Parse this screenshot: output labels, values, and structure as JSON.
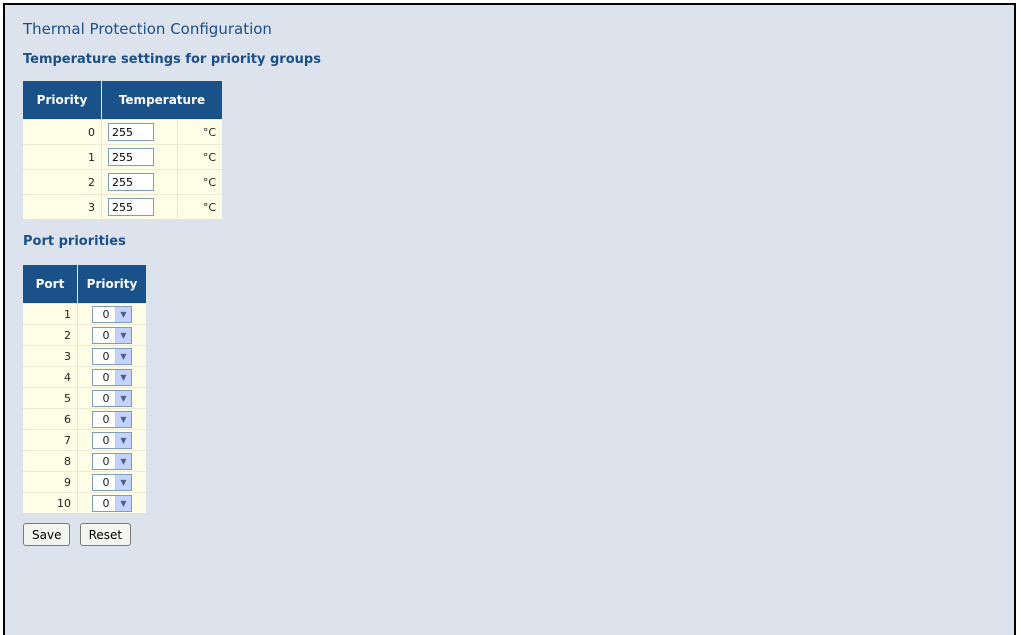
{
  "page_title": "Thermal Protection Configuration",
  "temperature_section": {
    "heading": "Temperature settings for priority groups",
    "columns": [
      "Priority",
      "Temperature"
    ],
    "rows": [
      {
        "priority": "0",
        "temperature": "255",
        "unit": "°C"
      },
      {
        "priority": "1",
        "temperature": "255",
        "unit": "°C"
      },
      {
        "priority": "2",
        "temperature": "255",
        "unit": "°C"
      },
      {
        "priority": "3",
        "temperature": "255",
        "unit": "°C"
      }
    ]
  },
  "ports_section": {
    "heading": "Port priorities",
    "columns": [
      "Port",
      "Priority"
    ],
    "rows": [
      {
        "port": "1",
        "priority": "0"
      },
      {
        "port": "2",
        "priority": "0"
      },
      {
        "port": "3",
        "priority": "0"
      },
      {
        "port": "4",
        "priority": "0"
      },
      {
        "port": "5",
        "priority": "0"
      },
      {
        "port": "6",
        "priority": "0"
      },
      {
        "port": "7",
        "priority": "0"
      },
      {
        "port": "8",
        "priority": "0"
      },
      {
        "port": "9",
        "priority": "0"
      },
      {
        "port": "10",
        "priority": "0"
      }
    ]
  },
  "buttons": {
    "save": "Save",
    "reset": "Reset"
  },
  "icons": {
    "dropdown": "chevron-down-icon"
  },
  "colors": {
    "background": "#dde3ec",
    "header": "#1a5189",
    "title": "#1b4f8a",
    "row": "#fefee6"
  }
}
